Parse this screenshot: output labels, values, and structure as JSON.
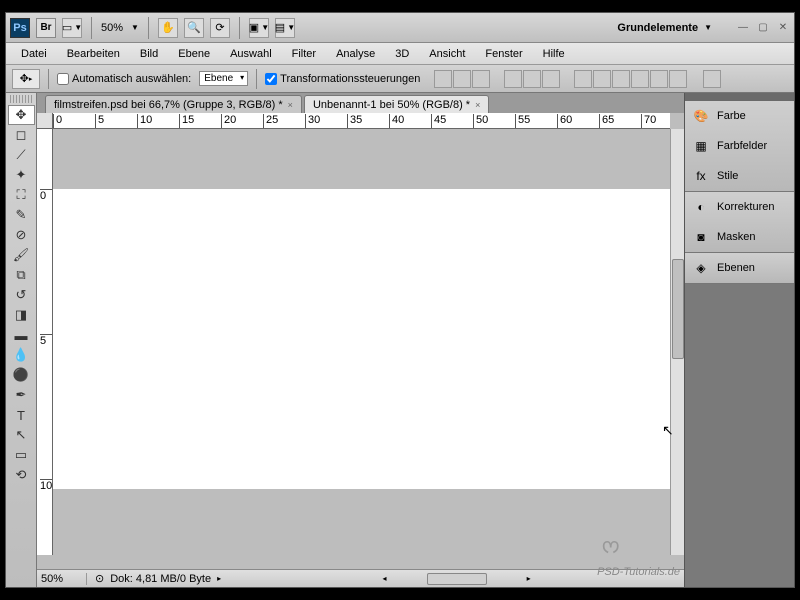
{
  "topbar": {
    "zoom": "50%",
    "workspace": "Grundelemente"
  },
  "menu": [
    "Datei",
    "Bearbeiten",
    "Bild",
    "Ebene",
    "Auswahl",
    "Filter",
    "Analyse",
    "3D",
    "Ansicht",
    "Fenster",
    "Hilfe"
  ],
  "options": {
    "auto_select": "Automatisch auswählen:",
    "layer_select": "Ebene",
    "transform": "Transformationssteuerungen"
  },
  "tabs": [
    {
      "label": "filmstreifen.psd bei 66,7% (Gruppe 3, RGB/8) *",
      "active": false
    },
    {
      "label": "Unbenannt-1 bei 50% (RGB/8) *",
      "active": true
    }
  ],
  "ruler_h": [
    "0",
    "5",
    "10",
    "15",
    "20",
    "25",
    "30",
    "35",
    "40",
    "45",
    "50",
    "55",
    "60",
    "65",
    "70"
  ],
  "ruler_v": [
    "0",
    "5",
    "10"
  ],
  "status": {
    "zoom": "50%",
    "doc": "Dok: 4,81 MB/0 Byte"
  },
  "panels": {
    "g1": [
      {
        "icon": "🎨",
        "label": "Farbe"
      },
      {
        "icon": "▦",
        "label": "Farbfelder"
      },
      {
        "icon": "fx",
        "label": "Stile"
      }
    ],
    "g2": [
      {
        "icon": "◐",
        "label": "Korrekturen"
      },
      {
        "icon": "◙",
        "label": "Masken"
      }
    ],
    "g3": [
      {
        "icon": "◈",
        "label": "Ebenen"
      }
    ]
  },
  "watermark": "PSD-Tutorials.de"
}
